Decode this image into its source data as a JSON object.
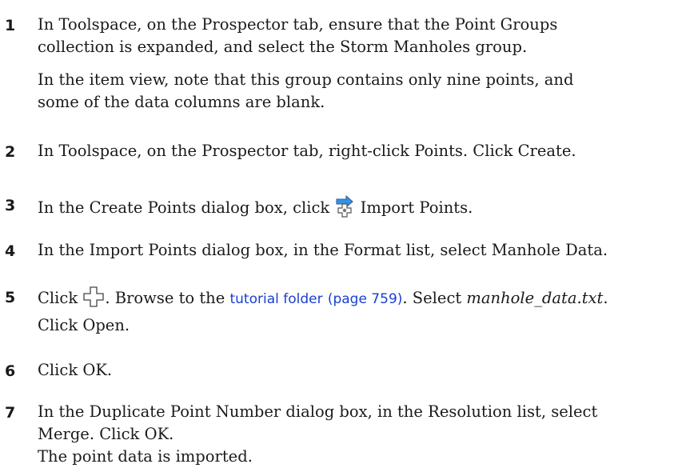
{
  "steps": [
    {
      "num": "1",
      "lines": [
        "In Toolspace, on the Prospector tab, ensure that the Point Groups",
        "collection is expanded, and select the Storm Manholes group."
      ],
      "note": [
        "In the item view, note that this group contains only nine points, and",
        "some of the data columns are blank."
      ]
    },
    {
      "num": "2",
      "text": "In Toolspace, on the Prospector tab, right-click Points. Click Create."
    },
    {
      "num": "3",
      "before": "In the Create Points dialog box, click ",
      "after": " Import Points.",
      "icon": "import-points-icon"
    },
    {
      "num": "4",
      "text": "In the Import Points dialog box, in the Format list, select Manhole Data."
    },
    {
      "num": "5",
      "before": "Click ",
      "mid": ". Browse to the ",
      "link": "tutorial folder",
      "pageref": "(page 759)",
      "after": ". Select ",
      "file": "manhole_data.txt",
      "end": ".",
      "line2": "Click Open.",
      "icon": "browse-icon"
    },
    {
      "num": "6",
      "text": "Click OK."
    },
    {
      "num": "7",
      "lines": [
        "In the Duplicate Point Number dialog box, in the Resolution list, select",
        "Merge. Click OK."
      ],
      "note": [
        "The point data is imported."
      ]
    }
  ]
}
